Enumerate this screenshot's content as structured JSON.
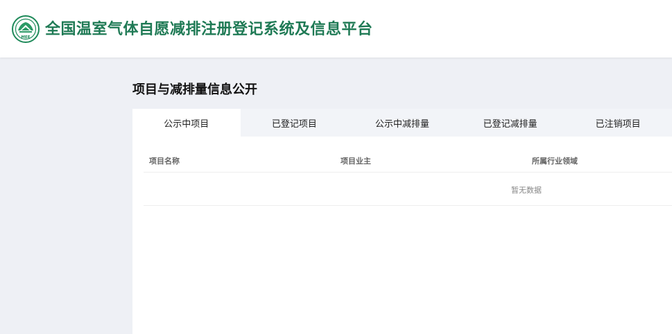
{
  "header": {
    "logo_text": "MEE",
    "title": "全国温室气体自愿减排注册登记系统及信息平台"
  },
  "section": {
    "title": "项目与减排量信息公开"
  },
  "tabs": [
    {
      "label": "公示中项目",
      "active": true
    },
    {
      "label": "已登记项目",
      "active": false
    },
    {
      "label": "公示中减排量",
      "active": false
    },
    {
      "label": "已登记减排量",
      "active": false
    },
    {
      "label": "已注销项目",
      "active": false
    }
  ],
  "table": {
    "columns": [
      "项目名称",
      "项目业主",
      "所属行业领域"
    ],
    "empty_text": "暂无数据"
  },
  "colors": {
    "brand_green": "#1f7a55",
    "page_bg": "#eef0f5",
    "tab_bar_bg": "#f2f4f8"
  }
}
